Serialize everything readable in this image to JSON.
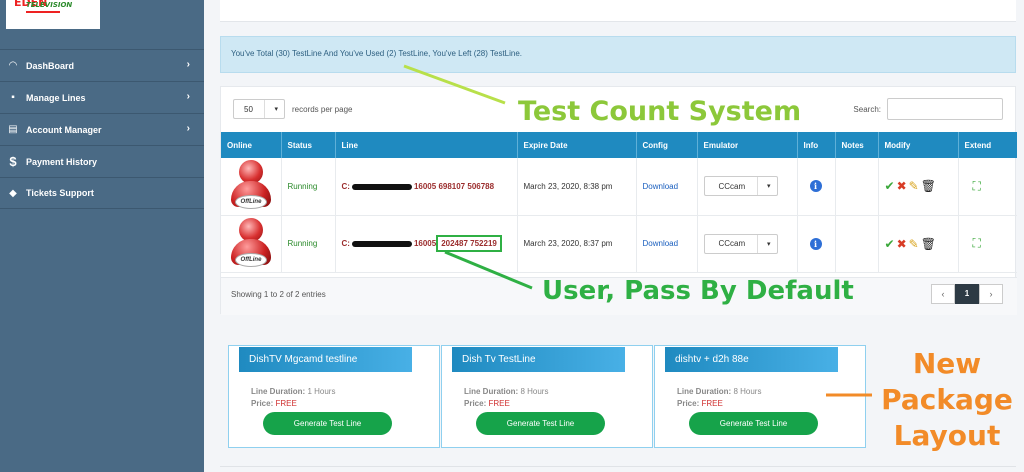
{
  "logo": {
    "top_text": "EDEN",
    "sub_text": "TELEVISION"
  },
  "sidebar": {
    "items": [
      {
        "label": "DashBoard",
        "icon": "gauge-icon",
        "chevron": "›"
      },
      {
        "label": "Manage Lines",
        "icon": "grid-icon",
        "chevron": "›"
      },
      {
        "label": "Account Manager",
        "icon": "contact-card-icon",
        "chevron": "›"
      },
      {
        "label": "Payment History",
        "icon": "dollar-icon"
      },
      {
        "label": "Tickets Support",
        "icon": "tag-icon"
      }
    ]
  },
  "alert": {
    "text": "You've Total (30) TestLine And You've Used (2) TestLine, You've Left (28) TestLine."
  },
  "table": {
    "length_value": "50",
    "length_label": "records per page",
    "search_label": "Search:",
    "columns": [
      "Online",
      "Status",
      "Line",
      "Expire Date",
      "Config",
      "Emulator",
      "Info",
      "Notes",
      "Modify",
      "Extend"
    ],
    "rows": [
      {
        "online_label": "OffLine",
        "status": "Running",
        "line_prefix": "C:",
        "line_num": "16005",
        "user": "698107",
        "pass": "506788",
        "expire": "March 23, 2020, 8:38 pm",
        "config": "Download",
        "emulator": "CCcam",
        "notes": ""
      },
      {
        "online_label": "OffLine",
        "status": "Running",
        "line_prefix": "C:",
        "line_num": "16005",
        "user": "202487",
        "pass": "752219",
        "expire": "March 23, 2020, 8:37 pm",
        "config": "Download",
        "emulator": "CCcam",
        "notes": ""
      }
    ],
    "showing": "Showing 1 to 2 of 2 entries",
    "pager": {
      "prev": "‹",
      "page": "1",
      "next": "›"
    }
  },
  "packages": [
    {
      "name": "DishTV Mgcamd testline",
      "duration_label": "Line Duration:",
      "duration": "1 Hours",
      "price_label": "Price:",
      "price": "FREE",
      "button": "Generate Test Line"
    },
    {
      "name": "Dish Tv TestLine",
      "duration_label": "Line Duration:",
      "duration": "8 Hours",
      "price_label": "Price:",
      "price": "FREE",
      "button": "Generate Test Line"
    },
    {
      "name": "dishtv + d2h 88e",
      "duration_label": "Line Duration:",
      "duration": "8 Hours",
      "price_label": "Price:",
      "price": "FREE",
      "button": "Generate Test Line"
    }
  ],
  "annotations": {
    "test_count": "Test Count System",
    "user_pass": "User, Pass By Default",
    "new_package_1": "New",
    "new_package_2": "Package",
    "new_package_3": "Layout"
  },
  "colors": {
    "sidebar": "#4a6a85",
    "header": "#1f8ac0",
    "green_button": "#16a34a",
    "annotation_green": "#8cc83a",
    "annotation_orange": "#f28b28"
  }
}
